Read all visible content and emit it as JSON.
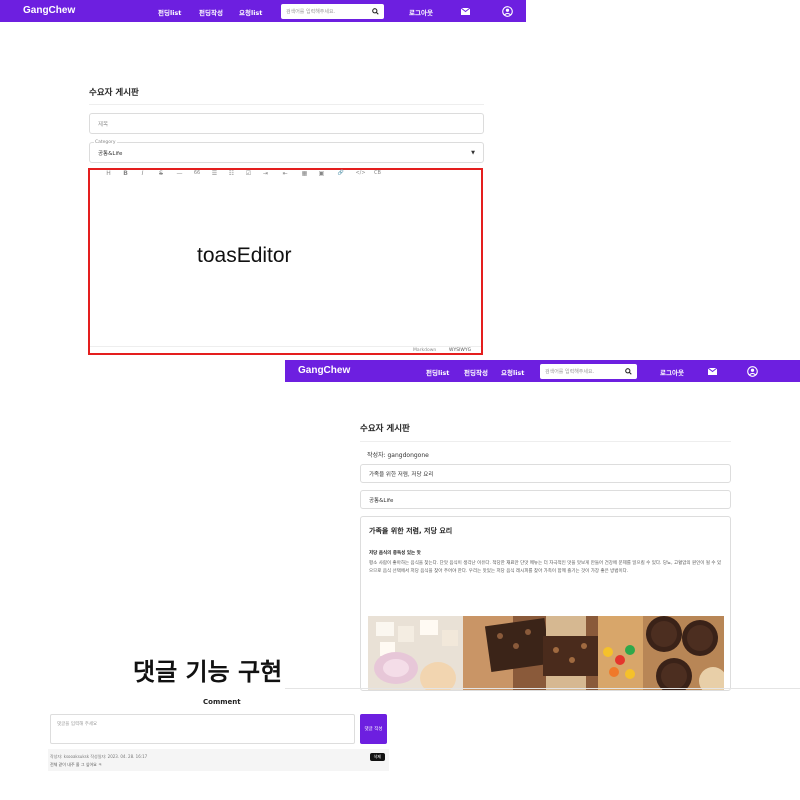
{
  "screen1": {
    "nav": {
      "logo": "GangChew",
      "links": [
        "펀딩list",
        "펀딩작성",
        "요청list"
      ],
      "search_placeholder": "검색어를 입력해주세요.",
      "logout": "로그아웃"
    },
    "board_title": "수요자 게시판",
    "title_placeholder": "제목",
    "category_label": "Category",
    "category_value": "공통&Life",
    "toolbar": [
      "H",
      "B",
      "I",
      "S",
      "—",
      "66",
      "☰",
      "☷",
      "☑",
      "⇥",
      "⇤",
      "▦",
      "▣",
      "🔗",
      "</>",
      "CB"
    ],
    "editor_label": "toasEditor",
    "modes": [
      "Markdown",
      "WYSIWYG"
    ]
  },
  "screen2": {
    "nav": {
      "logo": "GangChew",
      "links": [
        "펀딩list",
        "펀딩작성",
        "요청list"
      ],
      "search_placeholder": "검색어를 입력해주세요.",
      "logout": "로그아웃"
    },
    "board_title": "수요자 게시판",
    "author": "작성자: gangdongone",
    "post_title": "가족을 위한 저렴, 저당 요리",
    "category": "공통&Life",
    "content": {
      "heading": "가족을 위한 저렴, 저당 요리",
      "subheading": "저당 음식의 중독성 있는 맛",
      "paragraph": "평소 사람이 좋아하는 음식을 찾는다. 단맛 음식이 생각난 이유다. 적당한 재료만 단맛 메뉴는 더 자극적인 맛을 맛보게 만들어 건강에 문제를 일으킬 수 있다. 당뇨, 고혈압의 원인이 될 수 있으므로 음식 선택에서 저당 음식을 찾아 주어야 한다. 우리는 맛있는 저당 음식 레시피를 찾아 가족이 함께 즐기는 것이 가장 좋은 방법이다."
    }
  },
  "screen3": {
    "label": "댓글 기능 구현",
    "comment_heading": "Comment",
    "comment_placeholder": "댓글을 입력해 주세요",
    "submit": "댓글 작성",
    "comment_meta": "작성자: ksooaksuksk    작성일자: 2023. 04. 28. 16:17",
    "comment_text": "전체 같이 내주 올 그 싶어요 ㅋ",
    "delete": "삭제"
  },
  "colors": {
    "brand": "#6d1fe0",
    "highlight": "#e41e1e"
  }
}
